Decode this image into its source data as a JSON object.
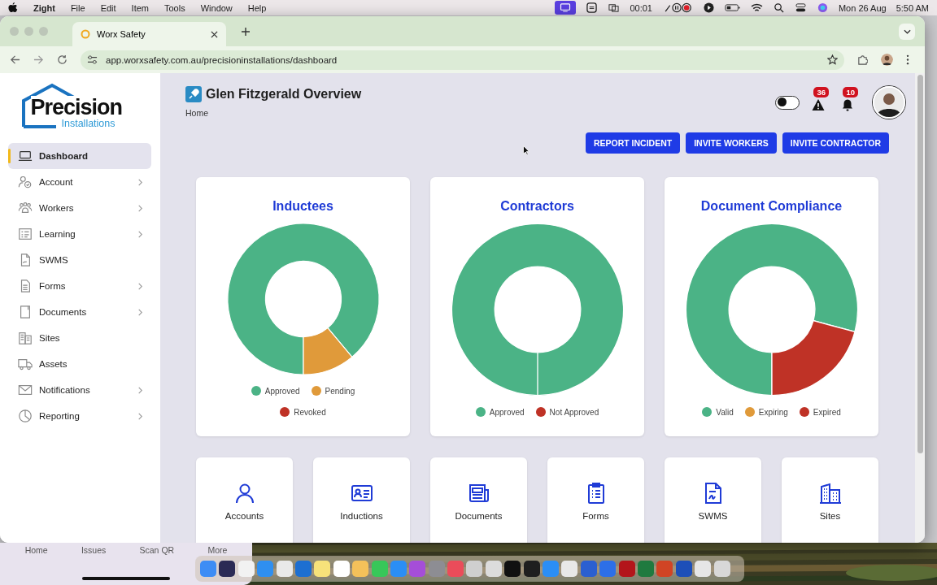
{
  "menu_bar": {
    "app_name": "Zight",
    "menus": [
      "File",
      "Edit",
      "Item",
      "Tools",
      "Window",
      "Help"
    ],
    "timer": "00:01",
    "date": "Mon 26 Aug",
    "time": "5:50 AM"
  },
  "browser": {
    "tab": {
      "title": "Worx Safety"
    },
    "url": "app.worxsafety.com.au/precisioninstallations/dashboard"
  },
  "sidebar": {
    "logo": {
      "name": "Precision",
      "tagline": "Installations"
    },
    "items": [
      {
        "label": "Dashboard",
        "selected": true,
        "expandable": false
      },
      {
        "label": "Account",
        "selected": false,
        "expandable": true
      },
      {
        "label": "Workers",
        "selected": false,
        "expandable": true
      },
      {
        "label": "Learning",
        "selected": false,
        "expandable": true
      },
      {
        "label": "SWMS",
        "selected": false,
        "expandable": false
      },
      {
        "label": "Forms",
        "selected": false,
        "expandable": true
      },
      {
        "label": "Documents",
        "selected": false,
        "expandable": true
      },
      {
        "label": "Sites",
        "selected": false,
        "expandable": false
      },
      {
        "label": "Assets",
        "selected": false,
        "expandable": false
      },
      {
        "label": "Notifications",
        "selected": false,
        "expandable": true
      },
      {
        "label": "Reporting",
        "selected": false,
        "expandable": true
      }
    ]
  },
  "header": {
    "title": "Glen Fitzgerald Overview",
    "breadcrumb": "Home",
    "toggle": {
      "on": false
    },
    "alerts_badge": "36",
    "notifications_badge": "10"
  },
  "actions": [
    "REPORT INCIDENT",
    "INVITE WORKERS",
    "INVITE CONTRACTOR"
  ],
  "charts": [
    {
      "title": "Inductees",
      "legend": [
        {
          "label": "Approved",
          "color": "#4bb386"
        },
        {
          "label": "Pending",
          "color": "#e09a3a"
        },
        {
          "label": "Revoked",
          "color": "#bf3226"
        }
      ]
    },
    {
      "title": "Contractors",
      "legend": [
        {
          "label": "Approved",
          "color": "#4bb386"
        },
        {
          "label": "Not Approved",
          "color": "#bf3226"
        }
      ]
    },
    {
      "title": "Document Compliance",
      "legend": [
        {
          "label": "Valid",
          "color": "#4bb386"
        },
        {
          "label": "Expiring",
          "color": "#e09a3a"
        },
        {
          "label": "Expired",
          "color": "#bf3226"
        }
      ]
    }
  ],
  "tiles": [
    {
      "label": "Accounts"
    },
    {
      "label": "Inductions"
    },
    {
      "label": "Documents"
    },
    {
      "label": "Forms"
    },
    {
      "label": "SWMS"
    },
    {
      "label": "Sites"
    }
  ],
  "mobile_nav": {
    "items": [
      "Home",
      "Issues",
      "Scan QR",
      "More"
    ]
  }
}
